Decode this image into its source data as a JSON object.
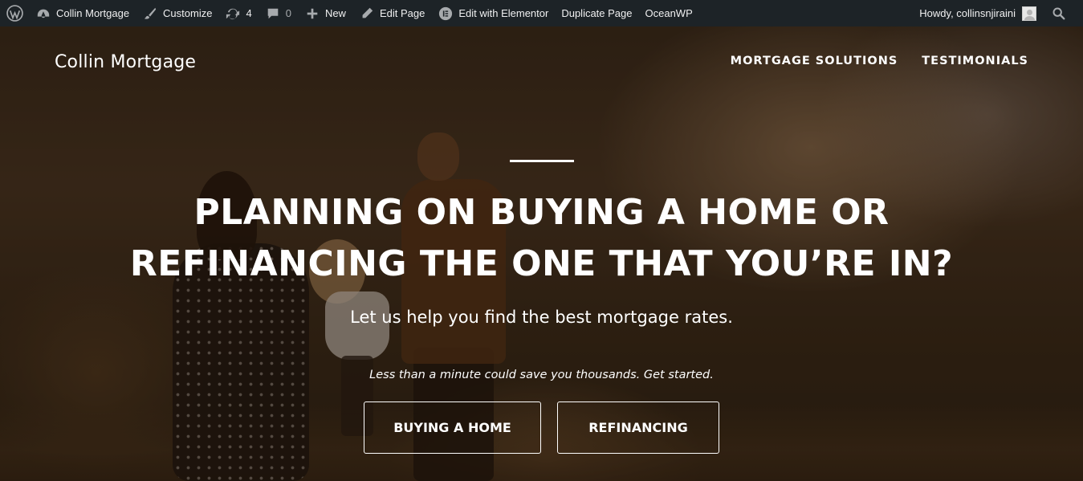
{
  "admin_bar": {
    "site_name": "Collin Mortgage",
    "customize": "Customize",
    "updates_count": "4",
    "comments_count": "0",
    "new": "New",
    "edit_page": "Edit Page",
    "edit_with_elementor": "Edit with Elementor",
    "duplicate_page": "Duplicate Page",
    "oceanwp": "OceanWP",
    "greeting": "Howdy, collinsnjiraini",
    "colors": {
      "background": "#1d2327",
      "text": "#f0f0f1",
      "icon": "#a7aaad"
    }
  },
  "header": {
    "site_title": "Collin Mortgage",
    "nav": [
      {
        "label": "MORTGAGE SOLUTIONS"
      },
      {
        "label": "TESTIMONIALS"
      }
    ]
  },
  "hero": {
    "headline_line1": "PLANNING ON BUYING A HOME OR",
    "headline_line2": "REFINANCING THE ONE THAT YOU’RE IN?",
    "subheadline": "Let us help you find the best mortgage rates.",
    "tagline": "Less than a minute could save you thousands. Get started.",
    "buttons": [
      {
        "label": "BUYING A HOME"
      },
      {
        "label": "REFINANCING"
      }
    ]
  }
}
